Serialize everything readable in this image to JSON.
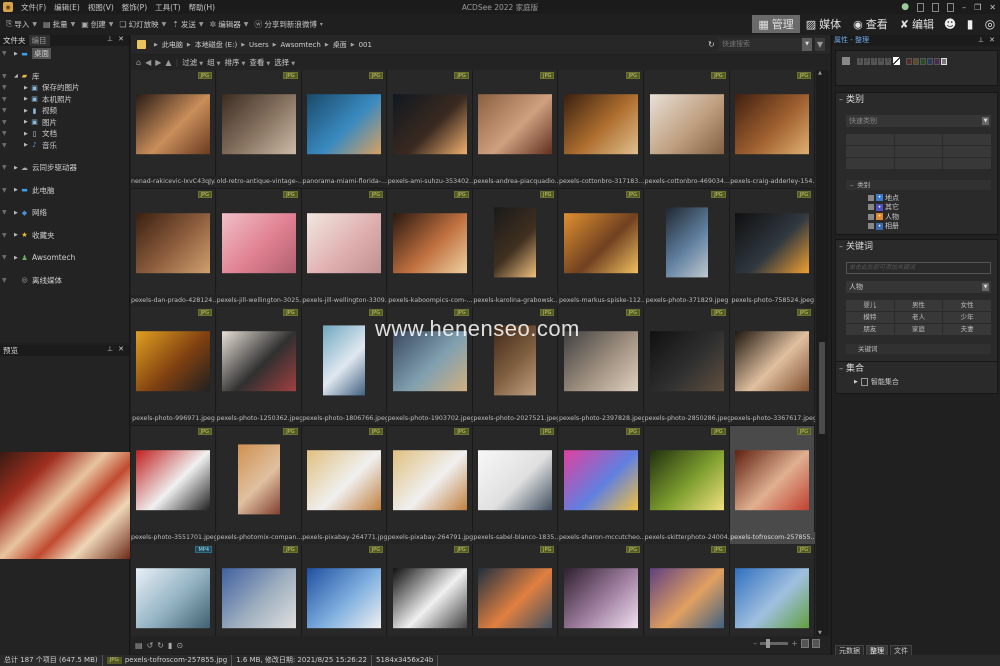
{
  "app": {
    "title": "ACDSee 2022 家庭版",
    "icon": "acdsee-logo"
  },
  "menu": [
    "文件(F)",
    "编辑(E)",
    "视图(V)",
    "整饰(P)",
    "工具(T)",
    "帮助(H)"
  ],
  "toolbar": {
    "buttons": [
      {
        "label": "导入",
        "icon": "import-icon"
      },
      {
        "label": "批量",
        "icon": "batch-icon"
      },
      {
        "label": "创建",
        "icon": "create-icon"
      },
      {
        "label": "幻灯放映",
        "icon": "slideshow-icon"
      },
      {
        "label": "发送",
        "icon": "send-icon"
      },
      {
        "label": "编辑器",
        "icon": "editor-icon"
      },
      {
        "label": "分享到新浪微博",
        "icon": "weibo-icon"
      }
    ]
  },
  "modes": [
    {
      "label": "管理",
      "icon": "grid-icon",
      "active": true
    },
    {
      "label": "媒体",
      "icon": "media-icon",
      "active": false
    },
    {
      "label": "查看",
      "icon": "eye-icon",
      "active": false
    },
    {
      "label": "编辑",
      "icon": "edit-icon",
      "active": false
    }
  ],
  "folders_panel": {
    "tabs": [
      "文件夹",
      "编目"
    ],
    "tree": [
      {
        "label": "桌面",
        "icon": "desktop-icon",
        "level": 0,
        "selected": true
      },
      {
        "label": "库",
        "icon": "library-icon",
        "level": 0,
        "expanded": true
      },
      {
        "label": "保存的图片",
        "icon": "pictures-icon",
        "level": 1
      },
      {
        "label": "本机照片",
        "icon": "pictures-icon",
        "level": 1
      },
      {
        "label": "视频",
        "icon": "video-icon",
        "level": 1
      },
      {
        "label": "图片",
        "icon": "pictures-icon",
        "level": 1
      },
      {
        "label": "文档",
        "icon": "document-icon",
        "level": 1
      },
      {
        "label": "音乐",
        "icon": "music-icon",
        "level": 1
      },
      {
        "label": "云同步驱动器",
        "icon": "cloud-icon",
        "level": 0
      },
      {
        "label": "此电脑",
        "icon": "computer-icon",
        "level": 0
      },
      {
        "label": "网络",
        "icon": "network-icon",
        "level": 0
      },
      {
        "label": "收藏夹",
        "icon": "star-icon",
        "level": 0
      },
      {
        "label": "Awsomtech",
        "icon": "user-icon",
        "level": 0
      },
      {
        "label": "离线媒体",
        "icon": "offline-media-icon",
        "level": 0
      }
    ]
  },
  "preview_panel": {
    "title": "预览"
  },
  "path": {
    "crumbs": [
      "此电脑",
      "本地磁盘 (E:)",
      "Users",
      "Awsomtech",
      "桌面",
      "001"
    ],
    "search_placeholder": "快速搜索"
  },
  "nav": {
    "menus": [
      "过滤",
      "组",
      "排序",
      "查看",
      "选择"
    ]
  },
  "files": [
    {
      "name": "nenad-rakicevic-IxvC43qJy...",
      "type": "JPG",
      "colors": [
        "#2a1c16",
        "#c98e5a",
        "#6b3a22"
      ]
    },
    {
      "name": "old-retro-antique-vintage-...",
      "type": "JPG",
      "colors": [
        "#3b2c22",
        "#8a7563",
        "#cbbba8"
      ]
    },
    {
      "name": "panorama-miami-florida-...",
      "type": "JPG",
      "colors": [
        "#1a4a6b",
        "#3a8ac0",
        "#d8a060"
      ]
    },
    {
      "name": "pexels-ami-suhzu-353402...",
      "type": "JPG",
      "colors": [
        "#101820",
        "#3a2a20",
        "#f0b070"
      ]
    },
    {
      "name": "pexels-andrea-piacquadio...",
      "type": "JPG",
      "colors": [
        "#8a6040",
        "#d0a080",
        "#603020"
      ]
    },
    {
      "name": "pexels-cottonbro-317183...",
      "type": "JPG",
      "colors": [
        "#3a2010",
        "#b07030",
        "#e0c090"
      ]
    },
    {
      "name": "pexels-cottonbro-469034...",
      "type": "JPG",
      "colors": [
        "#e8e0d8",
        "#c0a080",
        "#806040"
      ]
    },
    {
      "name": "pexels-craig-adderley-154...",
      "type": "JPG",
      "colors": [
        "#402010",
        "#a06030",
        "#e0b070"
      ]
    },
    {
      "name": "pexels-dan-prado-428124...",
      "type": "JPG",
      "colors": [
        "#3a2010",
        "#906040",
        "#d0a070"
      ]
    },
    {
      "name": "pexels-jill-wellington-3025...",
      "type": "JPG",
      "colors": [
        "#f0c0c8",
        "#e08090",
        "#b06070"
      ]
    },
    {
      "name": "pexels-jill-wellington-3309...",
      "type": "JPG",
      "colors": [
        "#f0e8e0",
        "#e0b0b0",
        "#c09090"
      ]
    },
    {
      "name": "pexels-kaboompics-com-...",
      "type": "JPG",
      "colors": [
        "#2a1810",
        "#c07040",
        "#f0d0a0"
      ]
    },
    {
      "name": "pexels-karolina-grabowsk...",
      "type": "JPG",
      "colors": [
        "#1a1a1a",
        "#403020",
        "#f0c080"
      ]
    },
    {
      "name": "pexels-markus-spiske-112...",
      "type": "JPG",
      "colors": [
        "#e09030",
        "#704020",
        "#f0c060"
      ]
    },
    {
      "name": "pexels-photo-371829.jpeg",
      "type": "JPG",
      "colors": [
        "#202830",
        "#6080a0",
        "#c0c8d0"
      ]
    },
    {
      "name": "pexels-photo-758524.jpeg",
      "type": "JPG",
      "colors": [
        "#101010",
        "#303840",
        "#f0a030"
      ]
    },
    {
      "name": "pexels-photo-996971.jpeg",
      "type": "JPG",
      "colors": [
        "#e0a020",
        "#804010",
        "#202020"
      ]
    },
    {
      "name": "pexels-photo-1250362.jpeg",
      "type": "JPG",
      "colors": [
        "#e8e0d8",
        "#303030",
        "#a04040"
      ]
    },
    {
      "name": "pexels-photo-1806766.jpeg",
      "type": "JPG",
      "colors": [
        "#70a8c0",
        "#e0e8f0",
        "#406080"
      ]
    },
    {
      "name": "pexels-photo-1903702.jpeg",
      "type": "JPG",
      "colors": [
        "#3a4860",
        "#80a0b0",
        "#d0b080"
      ]
    },
    {
      "name": "pexels-photo-2027521.jpeg",
      "type": "JPG",
      "colors": [
        "#402818",
        "#806040",
        "#c0a080"
      ]
    },
    {
      "name": "pexels-photo-2397828.jpeg",
      "type": "JPG",
      "colors": [
        "#404040",
        "#a09080",
        "#e0d0c0"
      ]
    },
    {
      "name": "pexels-photo-2850286.jpeg",
      "type": "JPG",
      "colors": [
        "#101010",
        "#303030",
        "#605040"
      ]
    },
    {
      "name": "pexels-photo-3367617.jpeg",
      "type": "JPG",
      "colors": [
        "#201810",
        "#e0c0a0",
        "#805030"
      ]
    },
    {
      "name": "pexels-photo-3551701.jpeg",
      "type": "JPG",
      "colors": [
        "#c02020",
        "#f0f0f0",
        "#202020"
      ]
    },
    {
      "name": "pexels-photomix-compan...",
      "type": "JPG",
      "colors": [
        "#d09050",
        "#e0c0a0",
        "#804030"
      ]
    },
    {
      "name": "pexels-pixabay-264771.jpg",
      "type": "JPG",
      "colors": [
        "#e0c080",
        "#f0f0f0",
        "#c08040"
      ]
    },
    {
      "name": "pexels-pixabay-264791.jpg",
      "type": "JPG",
      "colors": [
        "#e0c080",
        "#f0f0f0",
        "#c08040"
      ]
    },
    {
      "name": "pexels-sabel-blanco-1835...",
      "type": "JPG",
      "colors": [
        "#f8f8f8",
        "#e0e0e0",
        "#405060"
      ]
    },
    {
      "name": "pexels-sharon-mccutcheo...",
      "type": "JPG",
      "colors": [
        "#e040a0",
        "#6080e0",
        "#f0c040"
      ]
    },
    {
      "name": "pexels-skitterphoto-24004...",
      "type": "JPG",
      "colors": [
        "#203010",
        "#80a030",
        "#f0e080"
      ]
    },
    {
      "name": "pexels-tofroscom-257855...",
      "type": "JPG",
      "colors": [
        "#602010",
        "#e0b090",
        "#c04030"
      ],
      "selected": true
    },
    {
      "name": "",
      "type": "MP4",
      "colors": [
        "#e8f0f8",
        "#90b0c0",
        "#406070"
      ]
    },
    {
      "name": "",
      "type": "JPG",
      "colors": [
        "#4060a0",
        "#a0b0c0",
        "#e0e0e0"
      ]
    },
    {
      "name": "",
      "type": "JPG",
      "colors": [
        "#2050a0",
        "#80b0e0",
        "#f0f0f0"
      ]
    },
    {
      "name": "",
      "type": "JPG",
      "colors": [
        "#101010",
        "#f0f0f0",
        "#404040"
      ]
    },
    {
      "name": "",
      "type": "JPG",
      "colors": [
        "#203040",
        "#e08040",
        "#405060"
      ]
    },
    {
      "name": "",
      "type": "JPG",
      "colors": [
        "#302030",
        "#a080a0",
        "#f0e0f0"
      ]
    },
    {
      "name": "",
      "type": "JPG",
      "colors": [
        "#604080",
        "#e0a060",
        "#406080"
      ]
    },
    {
      "name": "",
      "type": "JPG",
      "colors": [
        "#3070c0",
        "#a0c0e0",
        "#60a040"
      ]
    }
  ],
  "viewbar": {
    "zoom_level": 0.25
  },
  "properties": {
    "title": "属性 - 整理",
    "ratings": [
      "1",
      "2",
      "3",
      "4",
      "5"
    ],
    "label_colors": [
      "#8a2a2a",
      "#8a6a2a",
      "#2a6a2a",
      "#2a4a8a",
      "#6a2a6a"
    ],
    "category": {
      "title": "类别",
      "quick_label": "快速类别",
      "subhead": "类别",
      "items": [
        {
          "label": "地点",
          "icon": "globe-icon",
          "color": "#3a7ad0"
        },
        {
          "label": "其它",
          "icon": "other-icon",
          "color": "#5050c0"
        },
        {
          "label": "人物",
          "icon": "people-icon",
          "color": "#e08a30"
        },
        {
          "label": "相册",
          "icon": "album-icon",
          "color": "#3a6ab0"
        }
      ]
    },
    "keywords": {
      "title": "关键词",
      "input_placeholder": "单击此处即可添加关键词",
      "preset": "人物",
      "buttons": [
        "婴儿",
        "男性",
        "女性",
        "模特",
        "老人",
        "少年",
        "朋友",
        "家庭",
        "夫妻"
      ],
      "subhead": "关键词"
    },
    "collections": {
      "title": "集合",
      "item": "智能集合"
    },
    "tabs": [
      "元数据",
      "整理",
      "文件"
    ]
  },
  "status": {
    "total": "总计 187 个项目 (647.5 MB)",
    "file_type": "JPG",
    "file_name": "pexels-tofroscom-257855.jpg",
    "file_info": "1.6 MB, 修改日期: 2021/8/25 15:26:22",
    "dimensions": "5184x3456x24b"
  },
  "watermark": "www.henenseo.com"
}
